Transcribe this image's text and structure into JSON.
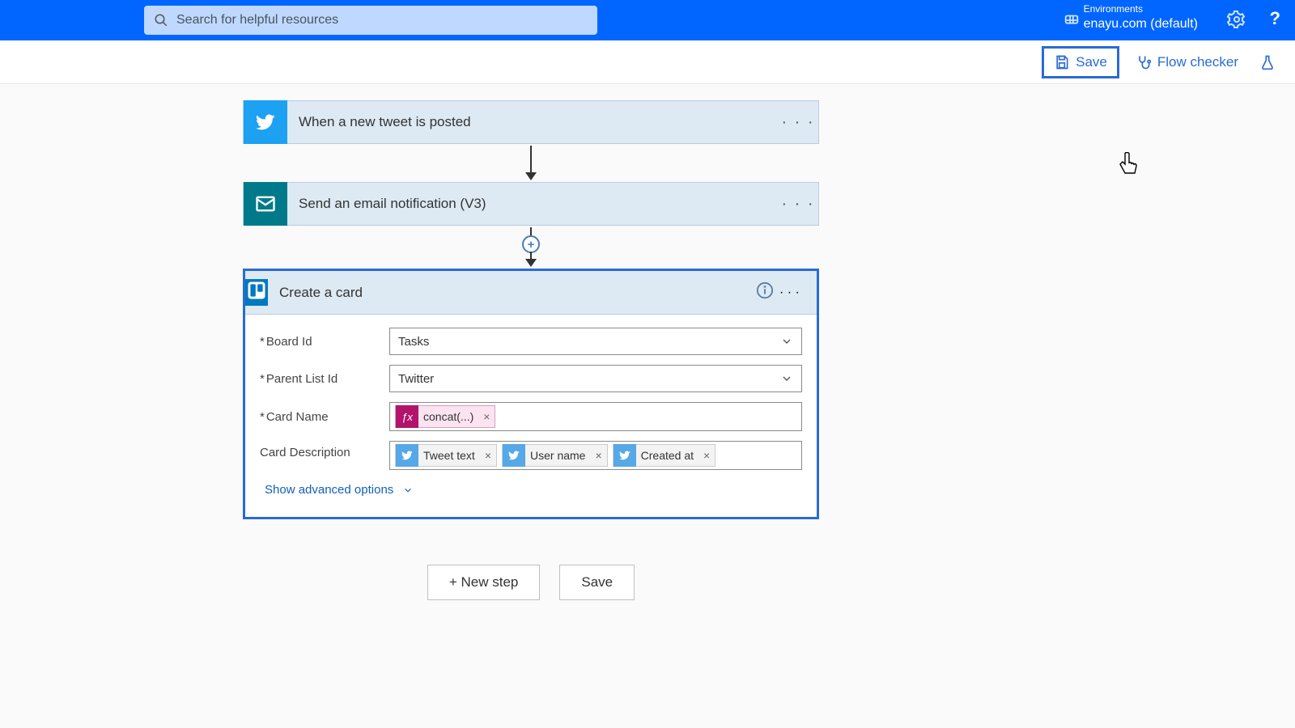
{
  "header": {
    "search_placeholder": "Search for helpful resources",
    "env_label": "Environments",
    "env_value": "enayu.com (default)"
  },
  "commandbar": {
    "save": "Save",
    "flow_checker": "Flow checker"
  },
  "flow": {
    "step1": {
      "title": "When a new tweet is posted"
    },
    "step2": {
      "title": "Send an email notification (V3)"
    },
    "card": {
      "title": "Create a card",
      "fields": {
        "board_label": "Board Id",
        "board_value": "Tasks",
        "list_label": "Parent List Id",
        "list_value": "Twitter",
        "name_label": "Card Name",
        "desc_label": "Card Description"
      },
      "name_tokens": {
        "fx": "concat(...)"
      },
      "desc_tokens": {
        "t1": "Tweet text",
        "t2": "User name",
        "t3": "Created at"
      },
      "advanced": "Show advanced options"
    }
  },
  "bottom": {
    "new_step": "+ New step",
    "save": "Save"
  }
}
